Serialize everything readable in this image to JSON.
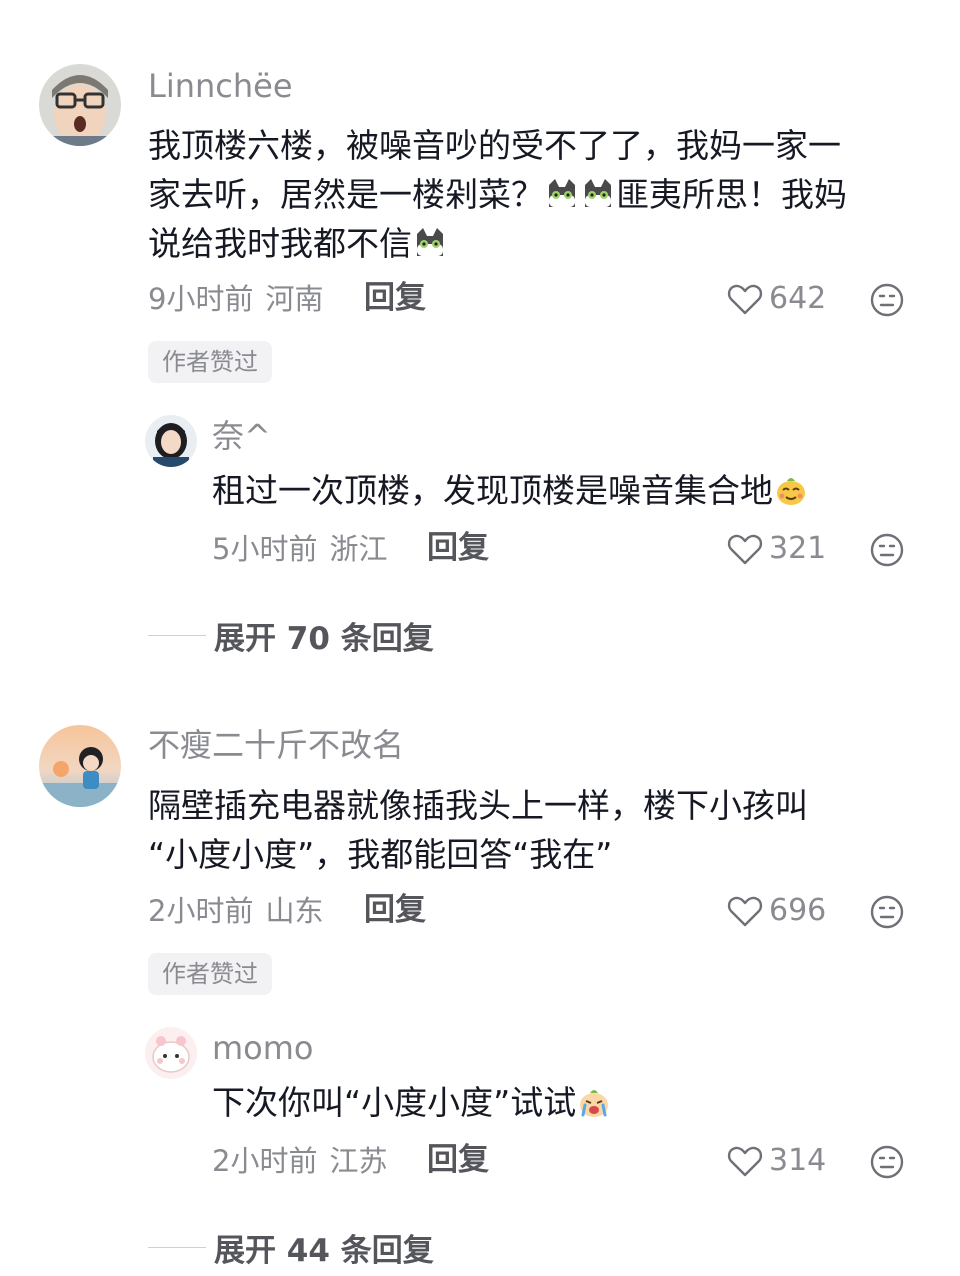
{
  "comments": [
    {
      "author": "Linnchëe",
      "text_lines": [
        "我顶楼六楼，被噪音吵的受不了了，我妈一家一",
        "家去听，居然是一楼剁菜？",
        "匪夷所思！我妈",
        "说给我时我都不信"
      ],
      "time": "9小时前",
      "location": "河南",
      "reply_label": "回复",
      "likes": "642",
      "badge": "作者赞过",
      "emojis": [
        "cat-emoji",
        "cat-emoji",
        "cat-emoji"
      ],
      "sub_reply": {
        "author": "奈^",
        "text": "租过一次顶楼，发现顶楼是噪音集合地",
        "emoji": "sly-face-emoji",
        "time": "5小时前",
        "location": "浙江",
        "reply_label": "回复",
        "likes": "321"
      },
      "expand_label": "展开 70 条回复"
    },
    {
      "author": "不瘦二十斤不改名",
      "text_lines": [
        "隔壁插充电器就像插我头上一样，楼下小孩叫",
        "“小度小度”，我都能回答“我在”"
      ],
      "time": "2小时前",
      "location": "山东",
      "reply_label": "回复",
      "likes": "696",
      "badge": "作者赞过",
      "sub_reply": {
        "author": "momo",
        "text": "下次你叫“小度小度”试试",
        "emoji": "crying-face-emoji",
        "time": "2小时前",
        "location": "江苏",
        "reply_label": "回复",
        "likes": "314"
      },
      "expand_label": "展开 44 条回复"
    }
  ],
  "icons": {
    "like": "heart-outline-icon",
    "dislike": "neutral-face-icon"
  },
  "colors": {
    "text_primary": "#161823",
    "text_secondary": "#8a8b91",
    "badge_bg": "#f2f2f4"
  }
}
